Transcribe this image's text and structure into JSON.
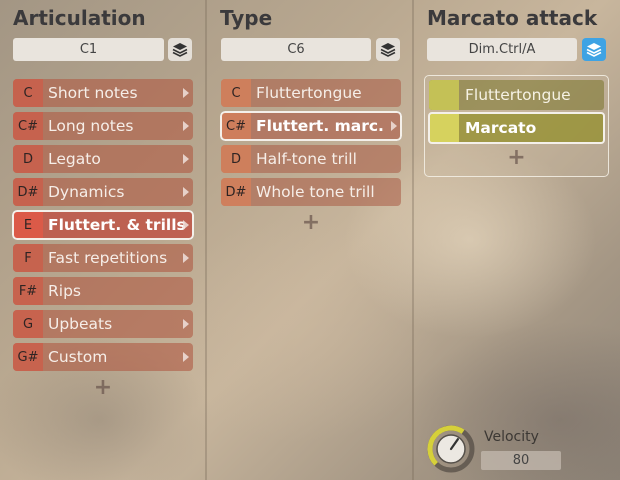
{
  "articulation": {
    "title": "Articulation",
    "selector": "C1",
    "items": [
      {
        "key": "C",
        "label": "Short notes",
        "has_arrow": true
      },
      {
        "key": "C#",
        "label": "Long notes",
        "has_arrow": true
      },
      {
        "key": "D",
        "label": "Legato",
        "has_arrow": true
      },
      {
        "key": "D#",
        "label": "Dynamics",
        "has_arrow": true
      },
      {
        "key": "E",
        "label": "Fluttert. & trills",
        "has_arrow": true,
        "selected": true
      },
      {
        "key": "F",
        "label": "Fast repetitions",
        "has_arrow": true
      },
      {
        "key": "F#",
        "label": "Rips",
        "has_arrow": false
      },
      {
        "key": "G",
        "label": "Upbeats",
        "has_arrow": true
      },
      {
        "key": "G#",
        "label": "Custom",
        "has_arrow": true
      }
    ],
    "add": "+"
  },
  "type": {
    "title": "Type",
    "selector": "C6",
    "items": [
      {
        "key": "C",
        "label": "Fluttertongue",
        "has_arrow": false
      },
      {
        "key": "C#",
        "label": "Fluttert. marc.",
        "has_arrow": true,
        "selected": true
      },
      {
        "key": "D",
        "label": "Half-tone trill",
        "has_arrow": false
      },
      {
        "key": "D#",
        "label": "Whole tone trill",
        "has_arrow": false
      }
    ],
    "add": "+"
  },
  "marcato": {
    "title": "Marcato attack",
    "selector": "Dim.Ctrl/A",
    "items": [
      {
        "label": "Fluttertongue",
        "selected": false
      },
      {
        "label": "Marcato",
        "selected": true
      }
    ],
    "add": "+",
    "layer_active_color": "#3ea3e4",
    "swatch_color": "#c4c156"
  },
  "velocity": {
    "label": "Velocity",
    "value": "80",
    "knob_fraction": 0.63,
    "arc_color": "#d6d03a"
  },
  "icons": {
    "layer": "layers-icon",
    "arrow": "chevron-right-icon",
    "add": "plus-icon"
  }
}
